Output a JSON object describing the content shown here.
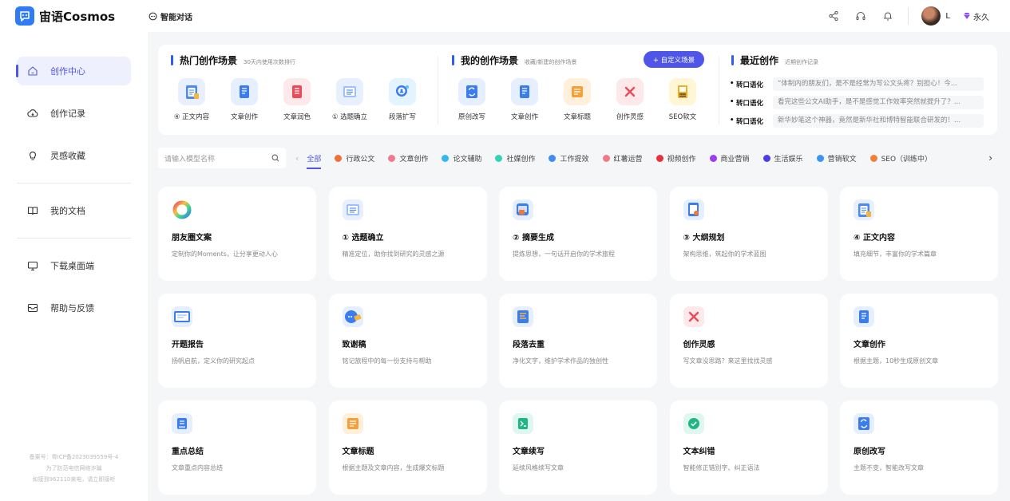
{
  "brand": {
    "name": "宙语Cosmos"
  },
  "header": {
    "chat_title": "智能对话",
    "user_name": "L",
    "vip": "永久"
  },
  "sidebar": {
    "items": [
      {
        "label": "创作中心",
        "icon": "home-icon",
        "active": true
      },
      {
        "label": "创作记录",
        "icon": "cloud-icon"
      },
      {
        "label": "灵感收藏",
        "icon": "bulb-icon"
      },
      {
        "label": "我的文档",
        "icon": "book-icon"
      },
      {
        "label": "下载桌面端",
        "icon": "monitor-icon"
      },
      {
        "label": "帮助与反馈",
        "icon": "feedback-icon"
      }
    ],
    "footer": [
      "备案号：粤ICP备2023039559号-4",
      "为了防范电信网络诈骗",
      "如接到962110来电，请立即接听"
    ]
  },
  "hot": {
    "title": "热门创作场景",
    "subtitle": "30天内使用次数排行",
    "items": [
      {
        "label": "④ 正文内容",
        "icon": "clipboard-icon",
        "color": "#e8f0ff"
      },
      {
        "label": "文章创作",
        "icon": "document-icon",
        "color": "#e6efff"
      },
      {
        "label": "文章润色",
        "icon": "red-document-icon",
        "color": "#fde8ea"
      },
      {
        "label": "① 选题确立",
        "icon": "checklist-icon",
        "color": "#e8f0ff"
      },
      {
        "label": "段落扩写",
        "icon": "search-person-icon",
        "color": "#e3f4ff"
      }
    ]
  },
  "mine": {
    "title": "我的创作场景",
    "subtitle": "收藏/新建的创作场景",
    "button": "+ 自定义场景",
    "items": [
      {
        "label": "原创改写",
        "icon": "rewrite-icon",
        "color": "#e6efff"
      },
      {
        "label": "文章创作",
        "icon": "document-icon",
        "color": "#e6efff"
      },
      {
        "label": "文章标题",
        "icon": "title-icon",
        "color": "#fff0dc"
      },
      {
        "label": "创作灵感",
        "icon": "tools-icon",
        "color": "#fde8ea"
      },
      {
        "label": "SEO软文",
        "icon": "seo-icon",
        "color": "#fff6d6"
      }
    ]
  },
  "recent": {
    "title": "最近创作",
    "subtitle": "近期创作记录",
    "items": [
      {
        "tag": "转口语化",
        "text": "“体制内的朋友们，是不是经常为写公文头疼？别担心！今..."
      },
      {
        "tag": "转口语化",
        "text": "看完这些公文AI助手，是不是感觉工作效率突然就提升了？..."
      },
      {
        "tag": "转口语化",
        "text": "新华妙笔这个神器，竟然是新华社和博特智能联合研发的！..."
      }
    ]
  },
  "filter": {
    "search_placeholder": "请输入模型名称",
    "tabs": [
      {
        "label": "全部",
        "active": true
      },
      {
        "label": "行政公文",
        "color": "#f0703a"
      },
      {
        "label": "文章创作",
        "color": "#f47a8f"
      },
      {
        "label": "论文辅助",
        "color": "#38b6f0"
      },
      {
        "label": "社媒创作",
        "color": "#34d3b8"
      },
      {
        "label": "工作提效",
        "color": "#3d8ef0"
      },
      {
        "label": "红薯运营",
        "color": "#f07a8c"
      },
      {
        "label": "视频创作",
        "color": "#e8313b"
      },
      {
        "label": "商业营销",
        "color": "#9b3df0"
      },
      {
        "label": "生活娱乐",
        "color": "#4b3ee8"
      },
      {
        "label": "营销软文",
        "color": "#3a96f0"
      },
      {
        "label": "SEO（训练中）",
        "color": "#f0803a"
      }
    ]
  },
  "cards": [
    {
      "title": "朋友圈文案",
      "desc": "定制你的Moments，让分享更动人心",
      "icon": "ring-icon",
      "color": "#ffffff"
    },
    {
      "title": "① 选题确立",
      "desc": "精准定位，助你找到研究的灵感之源",
      "icon": "checklist-icon",
      "color": "#e8f0ff"
    },
    {
      "title": "② 摘要生成",
      "desc": "提炼思想，一句话开启你的学术旅程",
      "icon": "summary-icon",
      "color": "#e6efff"
    },
    {
      "title": "③ 大纲规划",
      "desc": "架构思维，筑起你的学术蓝图",
      "icon": "outline-icon",
      "color": "#e6efff"
    },
    {
      "title": "④ 正文内容",
      "desc": "填充细节，丰富你的学术篇章",
      "icon": "clipboard-icon",
      "color": "#e8f0ff"
    },
    {
      "title": "开题报告",
      "desc": "扬帆启航，定义你的研究起点",
      "icon": "report-icon",
      "color": "#e6efff"
    },
    {
      "title": "致谢稿",
      "desc": "铭记旅程中的每一份支持与帮助",
      "icon": "thanks-icon",
      "color": "#e6efff"
    },
    {
      "title": "段落去重",
      "desc": "净化文字，维护学术作品的独创性",
      "icon": "dedupe-icon",
      "color": "#e6efff"
    },
    {
      "title": "创作灵感",
      "desc": "写文章没思路？来这里找找灵感",
      "icon": "tools-icon",
      "color": "#fde8ea"
    },
    {
      "title": "文章创作",
      "desc": "根据主题，10秒生成原创文章",
      "icon": "document-icon",
      "color": "#e6efff"
    },
    {
      "title": "重点总结",
      "desc": "文章重点内容总结",
      "icon": "summary-doc-icon",
      "color": "#e6efff"
    },
    {
      "title": "文章标题",
      "desc": "根据主题及文章内容，生成爆文标题",
      "icon": "title-icon",
      "color": "#fff0dc"
    },
    {
      "title": "文章续写",
      "desc": "延续风格续写文章",
      "icon": "continue-icon",
      "color": "#dff7ef"
    },
    {
      "title": "文本纠错",
      "desc": "智能修正错别字、纠正语法",
      "icon": "check-icon",
      "color": "#dff7ef"
    },
    {
      "title": "原创改写",
      "desc": "主题不变，智能改写文章",
      "icon": "rewrite-icon",
      "color": "#e6efff"
    }
  ]
}
